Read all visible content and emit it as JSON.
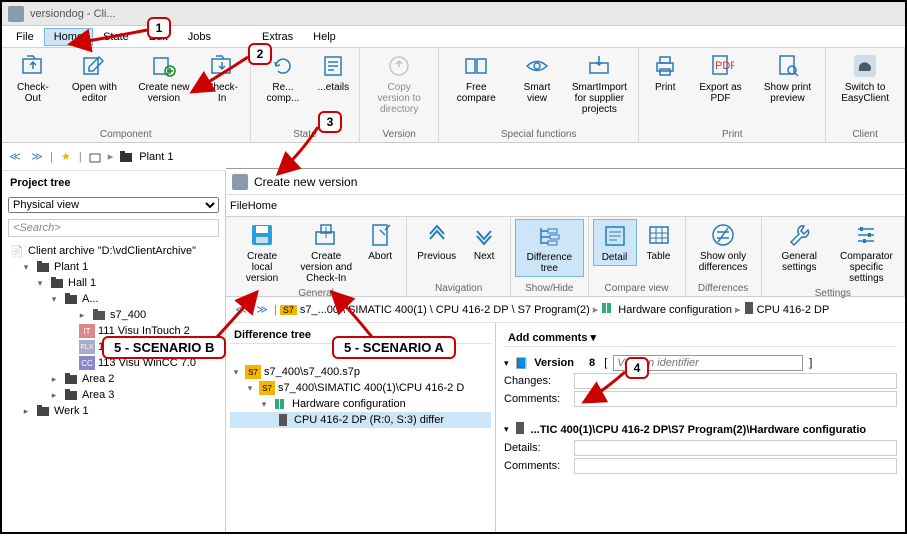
{
  "titlebar": {
    "text": "versiondog - Cli..."
  },
  "menu": {
    "file": "File",
    "home": "Home",
    "state": "State",
    "edit": "Edit",
    "jobs": "Jobs",
    "extras": "Extras",
    "help": "Help"
  },
  "ribbon": {
    "checkout": "Check-Out",
    "openeditor": "Open with editor",
    "createnew": "Create new version",
    "checkin": "Check-In",
    "comp": "Re... comp...",
    "details": "...etails",
    "copyver": "Copy version to directory",
    "freecomp": "Free compare",
    "smartview": "Smart view",
    "smartimport": "SmartImport for supplier projects",
    "print": "Print",
    "exportpdf": "Export as PDF",
    "printprev": "Show print preview",
    "easyclient": "Switch to EasyClient",
    "groups": {
      "component": "Component",
      "state": "State",
      "version": "Version",
      "special": "Special functions",
      "print": "Print",
      "client": "Client"
    }
  },
  "breadcrumb": {
    "plant": "Plant 1"
  },
  "tree": {
    "title": "Project tree",
    "viewsel": "Physical view",
    "search_placeholder": "<Search>",
    "archive": "Client archive \"D:\\vdClientArchive\"",
    "plant1": "Plant 1",
    "hall1": "Hall 1",
    "a": "A...",
    "s7400": "s7_400",
    "intouch": "111 Visu InTouch 2",
    "wincc1": "112 Visu WinCC Fle:",
    "wincc2": "113 Visu WinCC 7.0",
    "area2": "Area 2",
    "area3": "Area 3",
    "werk1": "Werk 1"
  },
  "subwin": {
    "title": "Create new version",
    "menu": {
      "file": "File",
      "home": "Home"
    },
    "ribbon": {
      "createlocal": "Create local version",
      "createcheckin": "Create version and Check-In",
      "abort": "Abort",
      "previous": "Previous",
      "next": "Next",
      "difftree": "Difference tree",
      "detail": "Detail",
      "table": "Table",
      "showonly": "Show only differences",
      "gensettings": "General settings",
      "compsettings": "Comparator specific settings",
      "groups": {
        "general": "General",
        "nav": "Navigation",
        "showhide": "Show/Hide",
        "compview": "Compare view",
        "diffs": "Differences",
        "settings": "Settings"
      }
    },
    "bc": {
      "p1": "s7_...00",
      "p2": "SIMATIC 400(1)",
      "p3": "CPU 416-2 DP",
      "p4": "S7 Program(2)",
      "hw": "Hardware configuration",
      "cpu": "CPU 416-2 DP"
    },
    "difftree": {
      "header": "Difference tree",
      "n1": "s7_400\\s7_400.s7p",
      "n2": "s7_400\\SIMATIC 400(1)\\CPU 416-2 D",
      "n3": "Hardware configuration",
      "n4": "CPU 416-2 DP (R:0, S:3) differ"
    },
    "detail": {
      "addcomments": "Add comments",
      "version_label": "Version",
      "version_num": "8",
      "version_ph": "Version identifier",
      "changes": "Changes:",
      "comments": "Comments:",
      "hwpath": "...TIC 400(1)\\CPU 416-2 DP\\S7 Program(2)\\Hardware configuratio",
      "details": "Details:"
    }
  },
  "callouts": {
    "c1": "1",
    "c2": "2",
    "c3": "3",
    "c4": "4",
    "s5b": "5 - SCENARIO B",
    "s5a": "5 - SCENARIO A"
  }
}
